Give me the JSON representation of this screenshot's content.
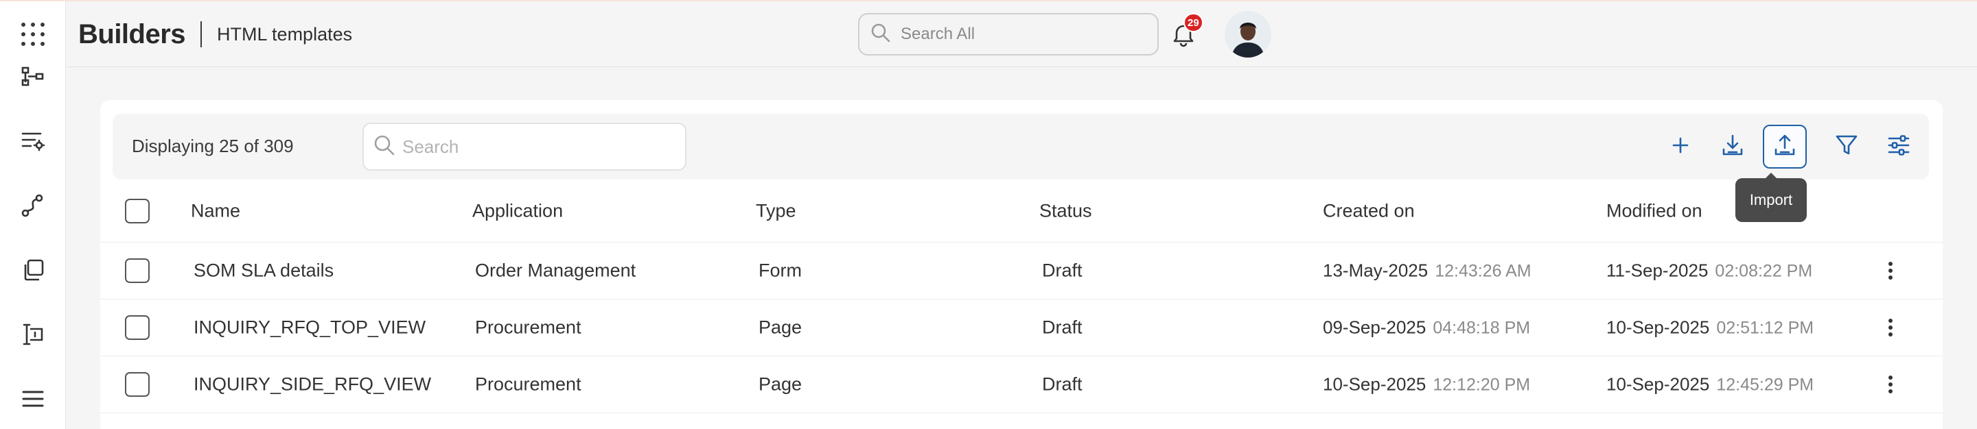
{
  "header": {
    "title": "Builders",
    "subtitle": "HTML templates",
    "search_placeholder": "Search All",
    "notification_count": "29"
  },
  "rail": {
    "items": [
      "apps-grid-icon",
      "hierarchy-icon",
      "list-settings-icon",
      "workflow-icon",
      "copy-icon",
      "text-cursor-icon",
      "menu-icon"
    ]
  },
  "toolbar": {
    "count_text": "Displaying 25 of 309",
    "search_placeholder": "Search",
    "buttons": [
      "add-icon",
      "download-icon",
      "upload-icon",
      "filter-icon",
      "sliders-icon"
    ],
    "tooltip": "Import"
  },
  "table": {
    "headers": {
      "name": "Name",
      "application": "Application",
      "type": "Type",
      "status": "Status",
      "created": "Created on",
      "modified": "Modified on"
    },
    "rows": [
      {
        "name": "SOM SLA details",
        "application": "Order Management",
        "type": "Form",
        "status": "Draft",
        "created_date": "13-May-2025",
        "created_time": "12:43:26 AM",
        "modified_date": "11-Sep-2025",
        "modified_time": "02:08:22 PM"
      },
      {
        "name": "INQUIRY_RFQ_TOP_VIEW",
        "application": "Procurement",
        "type": "Page",
        "status": "Draft",
        "created_date": "09-Sep-2025",
        "created_time": "04:48:18 PM",
        "modified_date": "10-Sep-2025",
        "modified_time": "02:51:12 PM"
      },
      {
        "name": "INQUIRY_SIDE_RFQ_VIEW",
        "application": "Procurement",
        "type": "Page",
        "status": "Draft",
        "created_date": "10-Sep-2025",
        "created_time": "12:12:20 PM",
        "modified_date": "10-Sep-2025",
        "modified_time": "12:45:29 PM"
      }
    ]
  },
  "colors": {
    "accent": "#1f5fa8",
    "badge": "#d82323",
    "tooltip_bg": "#4a4a4a"
  }
}
